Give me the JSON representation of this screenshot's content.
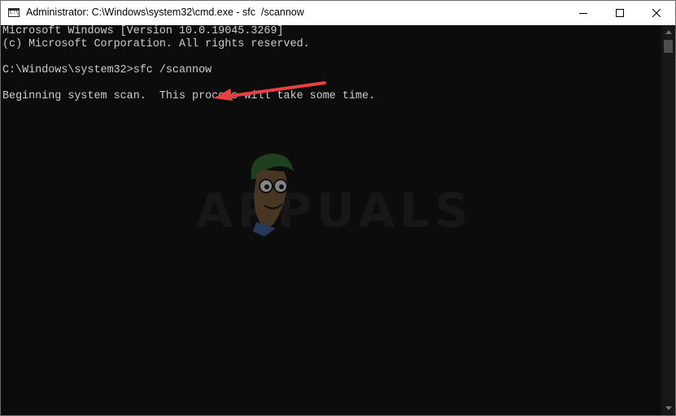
{
  "window": {
    "title": "Administrator: C:\\Windows\\system32\\cmd.exe - sfc  /scannow",
    "icon": "cmd-icon",
    "icon_text": "C:\\",
    "controls": [
      "minimize-icon",
      "maximize-icon",
      "close-icon"
    ]
  },
  "console": {
    "lines": [
      "Microsoft Windows [Version 10.0.19045.3269]",
      "(c) Microsoft Corporation. All rights reserved.",
      "C:\\Windows\\system32>sfc /scannow",
      "Beginning system scan.  This process will take some time."
    ],
    "background": "#0c0c0c",
    "foreground": "#cccccc"
  },
  "annotation": {
    "arrow_color": "#e8403f",
    "points_to": "sfc /scannow"
  },
  "watermark": {
    "text": "APPUALS"
  }
}
